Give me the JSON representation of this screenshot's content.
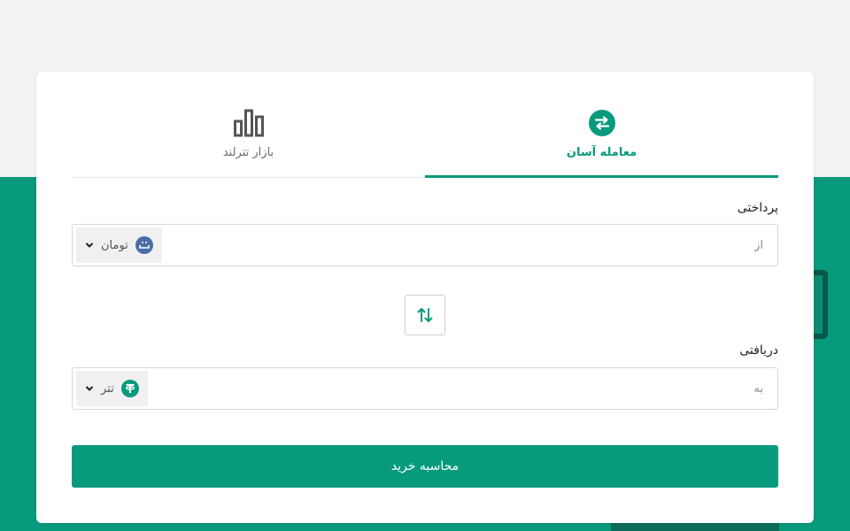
{
  "tabs": [
    {
      "label": "معامله آسان",
      "icon": "exchange-arrows-icon",
      "active": true
    },
    {
      "label": "بازار تترلند",
      "icon": "bar-chart-icon",
      "active": false
    }
  ],
  "pay": {
    "label": "پرداختی",
    "placeholder": "از",
    "currency": "تومان",
    "currency_icon": "toman-icon"
  },
  "receive": {
    "label": "دریافتی",
    "placeholder": "به",
    "currency": "تتر",
    "currency_icon": "tether-icon"
  },
  "swap": {
    "icon": "swap-vertical-icon"
  },
  "submit": {
    "label": "محاسبه خرید"
  },
  "colors": {
    "accent": "#079a7c",
    "toman_icon": "#4a6fa5",
    "page_bg": "#f3f3f3"
  }
}
